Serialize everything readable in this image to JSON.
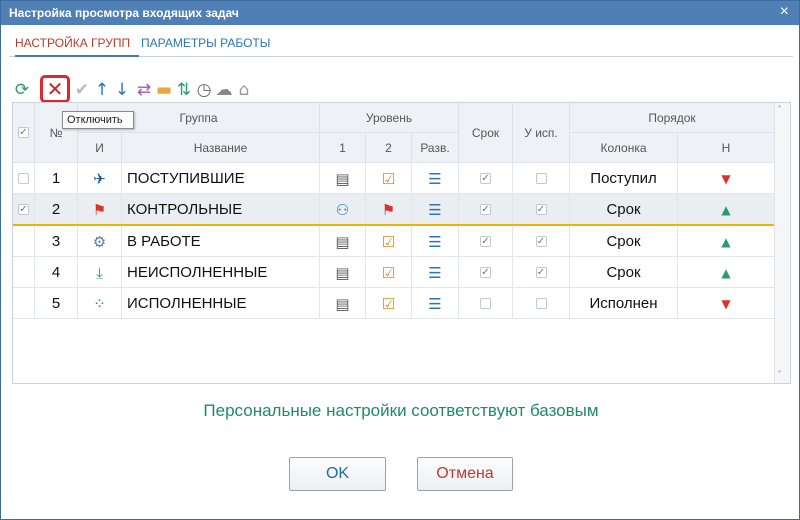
{
  "window": {
    "title": "Настройка просмотра входящих задач",
    "close": "×"
  },
  "tabs": [
    {
      "label": "НАСТРОЙКА ГРУПП"
    },
    {
      "label": "ПАРАМЕТРЫ РАБОТЫ"
    }
  ],
  "toolbar": {
    "refresh": "⟳",
    "delete": "✕",
    "check": "✔",
    "up": "↑",
    "down": "↓",
    "cycle": "⇄",
    "folder": "▬",
    "sort": "⇅",
    "clock": "◷",
    "cloud": "☁",
    "home": "⌂",
    "tooltip": "Отключить"
  },
  "grid": {
    "headers": {
      "check": "✓",
      "num": "№",
      "group": "Группа",
      "icon": "И",
      "name": "Название",
      "level": "Уровень",
      "l1": "1",
      "l2": "2",
      "razv": "Разв.",
      "srok": "Срок",
      "uisp": "У исп.",
      "order": "Порядок",
      "col": "Колонка",
      "h": "Н"
    },
    "rows": [
      {
        "num": "1",
        "icon": "✈",
        "name": "ПОСТУПИВШИЕ",
        "l1": "▤",
        "l2": "☑",
        "razv": "☰",
        "srok": "✓",
        "uisp": "",
        "check": "",
        "col": "Поступил",
        "dir": "▼"
      },
      {
        "num": "2",
        "icon": "⚑",
        "name": "КОНТРОЛЬНЫЕ",
        "l1": "⚇",
        "l2": "⚑",
        "razv": "☰",
        "srok": "✓",
        "uisp": "✓",
        "check": "✓",
        "col": "Срок",
        "dir": "▲"
      },
      {
        "num": "3",
        "icon": "⚙",
        "name": "В РАБОТЕ",
        "l1": "▤",
        "l2": "☑",
        "razv": "☰",
        "srok": "✓",
        "uisp": "✓",
        "check": "",
        "col": "Срок",
        "dir": "▲"
      },
      {
        "num": "4",
        "icon": "⤓",
        "name": "НЕИСПОЛНЕННЫЕ",
        "l1": "▤",
        "l2": "☑",
        "razv": "☰",
        "srok": "✓",
        "uisp": "✓",
        "check": "",
        "col": "Срок",
        "dir": "▲"
      },
      {
        "num": "5",
        "icon": "⁘",
        "name": "ИСПОЛНЕННЫЕ",
        "l1": "▤",
        "l2": "☑",
        "razv": "☰",
        "srok": "",
        "uisp": "",
        "check": "",
        "col": "Исполнен",
        "dir": "▼"
      }
    ]
  },
  "status": "Персональные настройки соответствуют базовым",
  "buttons": {
    "ok": "OK",
    "cancel": "Отмена"
  },
  "colors": {
    "accent": "#4f7fb4",
    "green": "#2e9a6a",
    "red": "#d9342b",
    "highlight": "#f0b400"
  }
}
